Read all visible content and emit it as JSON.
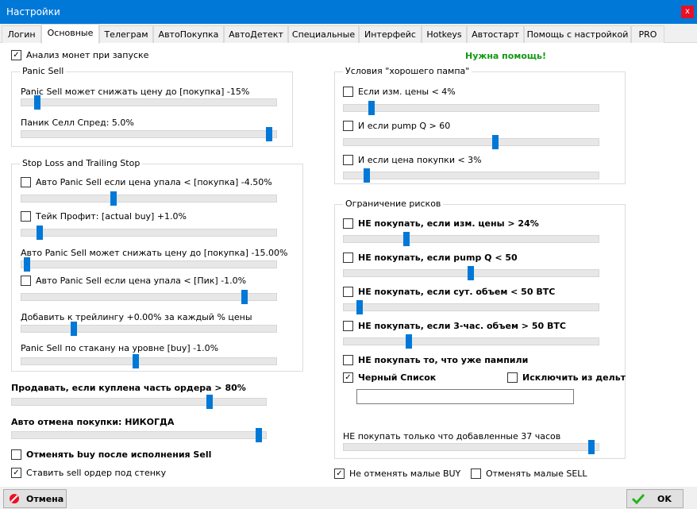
{
  "window": {
    "title": "Настройки",
    "close": "x"
  },
  "tabs": [
    "Логин",
    "Основные",
    "Телеграм",
    "АвтоПокупка",
    "АвтоДетект",
    "Специальные",
    "Интерфейс",
    "Hotkeys",
    "Автостарт",
    "Помощь с настройкой",
    "PRO"
  ],
  "active_tab": "Основные",
  "top": {
    "analyze_label": "Анализ монет при запуске",
    "analyze_checked": true,
    "help_link": "Нужна помощь!"
  },
  "panic": {
    "title": "Panic Sell",
    "price_label": "Panic Sell может снижать цену до [покупка] -15%",
    "price_pct": 0.05,
    "spread_label": "Паник Селл Спред: 5.0%",
    "spread_pct": 0.99
  },
  "stoploss": {
    "title": "Stop Loss and Trailing Stop",
    "auto_panic_label": "Авто Panic Sell если цена упала < [покупка] -4.50%",
    "auto_panic_checked": false,
    "auto_panic_pct": 0.36,
    "take_profit_label": "Тейк Профит: [actual buy] +1.0%",
    "take_profit_checked": false,
    "take_profit_pct": 0.06,
    "auto_price_label": "Авто Panic Sell может снижать цену до [покупка] -15.00%",
    "auto_price_pct": 0.01,
    "peak_label": "Авто Panic Sell если цена упала < [Пик] -1.0%",
    "peak_checked": false,
    "peak_pct": 0.89,
    "trailing_label": "Добавить к трейлингу +0.00% за каждый % цены",
    "trailing_pct": 0.2,
    "book_label": "Panic Sell по стакану на уровне [buy] -1.0%",
    "book_pct": 0.45
  },
  "left_bottom": {
    "sell_part_label": "Продавать, если куплена часть ордера > 80%",
    "sell_part_pct": 0.79,
    "auto_cancel_label": "Авто отмена покупки: НИКОГДА",
    "auto_cancel_pct": 0.99,
    "cancel_buy_label": "Отменять buy после исполнения Sell",
    "cancel_buy_checked": false,
    "wall_label": "Ставить sell ордер под стенку",
    "wall_checked": true
  },
  "pump": {
    "title": "Условия \"хорошего пампа\"",
    "price_label": "Если изм. цены < 4%",
    "price_checked": false,
    "price_pct": 0.1,
    "q_label": "И если pump Q > 60",
    "q_checked": false,
    "q_pct": 0.6,
    "buy_label": "И если цена покупки < 3%",
    "buy_checked": false,
    "buy_pct": 0.08
  },
  "risk": {
    "title": "Ограничение рисков",
    "price_label": "НЕ покупать, если изм. цены  > 24%",
    "price_checked": false,
    "price_pct": 0.24,
    "q_label": "НЕ покупать, если pump Q < 50",
    "q_checked": false,
    "q_pct": 0.5,
    "vol_label": "НЕ покупать, если сут. объем < 50 BTC",
    "vol_checked": false,
    "vol_pct": 0.05,
    "vol3_label": "НЕ покупать, если 3-час. объем > 50 BTC",
    "vol3_checked": false,
    "vol3_pct": 0.25,
    "pumped_label": "НЕ покупать то, что уже пампили",
    "pumped_checked": false,
    "blacklist_label": "Черный Список",
    "blacklist_checked": true,
    "exclude_label": "Исключить из дельт",
    "exclude_checked": false,
    "blacklist_value": "",
    "new_label": "НЕ покупать только что добавленные 37 часов",
    "new_pct": 0.99
  },
  "right_bottom": {
    "small_buy_label": "Не отменять малые BUY",
    "small_buy_checked": true,
    "small_sell_label": "Отменять малые SELL",
    "small_sell_checked": false
  },
  "buttons": {
    "cancel": "Отмена",
    "ok": "OK"
  },
  "colors": {
    "accent": "#0078d7",
    "help": "#139a13",
    "cancel_icon": "#e81123",
    "ok_icon": "#2bb21b"
  }
}
